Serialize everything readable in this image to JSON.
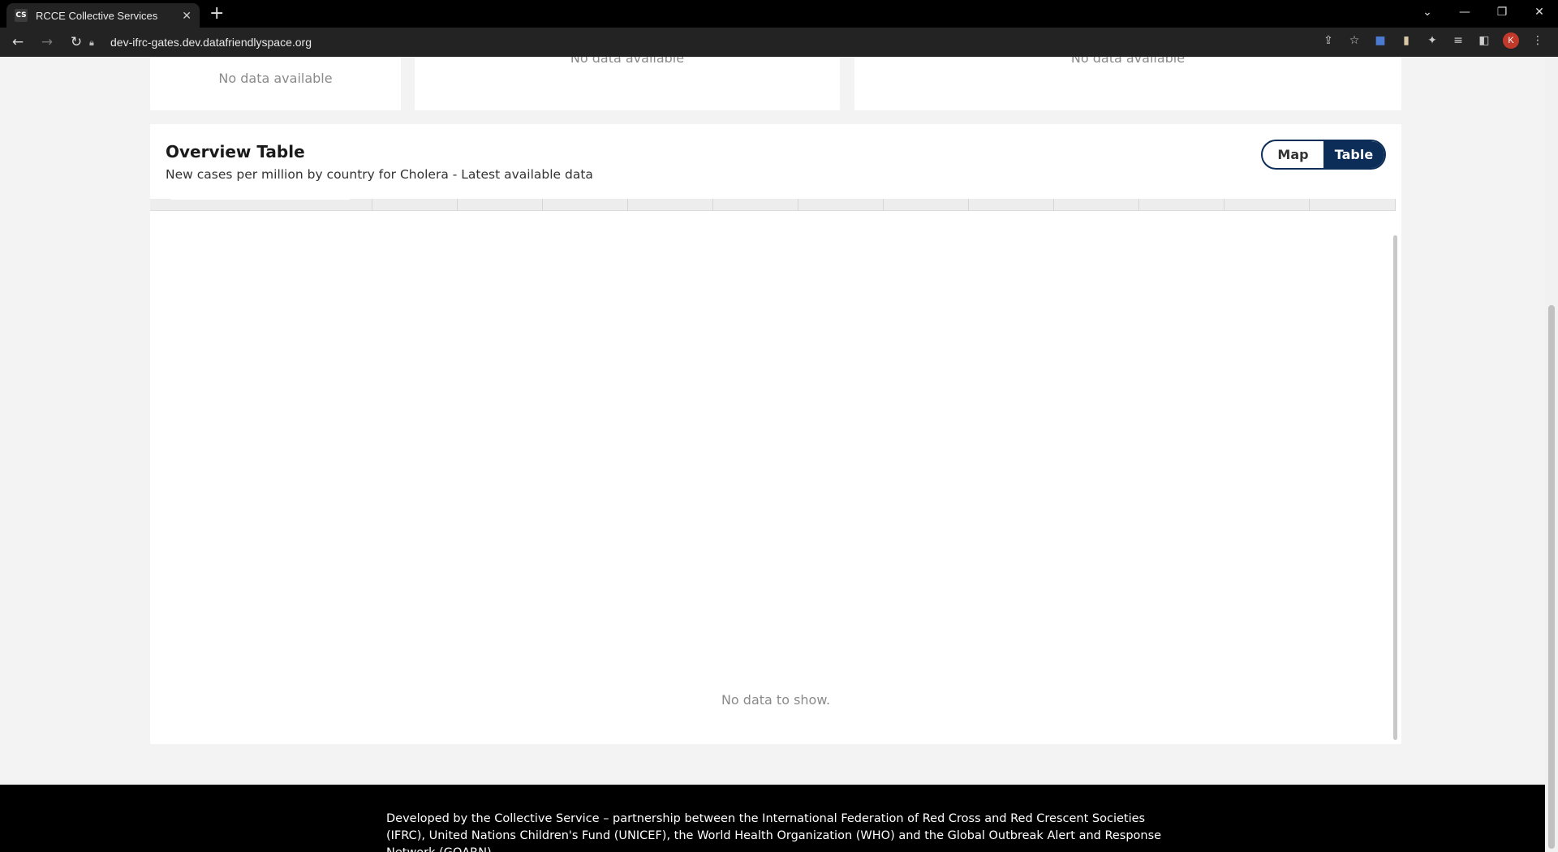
{
  "browser": {
    "tab": {
      "favicon_text": "CS",
      "title": "RCCE Collective Services",
      "close": "✕"
    },
    "new_tab": "+",
    "url": "dev-ifrc-gates.dev.datafriendlyspace.org",
    "profile_initial": "K",
    "icons": [
      "back-icon",
      "forward-icon",
      "reload-icon",
      "share-icon",
      "star-icon",
      "extension-icons",
      "puzzle-icon",
      "media-icon",
      "sidepanel-icon",
      "menu-icon"
    ]
  },
  "cards_top": {
    "card1_text": "No data available",
    "card2_text": "No data available",
    "card3_text": "No data available"
  },
  "overview": {
    "title": "Overview Table",
    "subtitle": "New cases per million by country for Cholera - Latest available data",
    "toggle": {
      "map_label": "Map",
      "table_label": "Table",
      "active": "Table"
    },
    "empty_text": "No data to show.",
    "colors": {
      "primary": "#0c2d57"
    }
  },
  "footer": {
    "text": "Developed by the Collective Service – partnership between the International Federation of Red Cross and Red Crescent Societies (IFRC), United Nations Children's Fund (UNICEF), the World Health Organization (WHO) and the Global Outbreak Alert and Response Network (GOARN)."
  }
}
